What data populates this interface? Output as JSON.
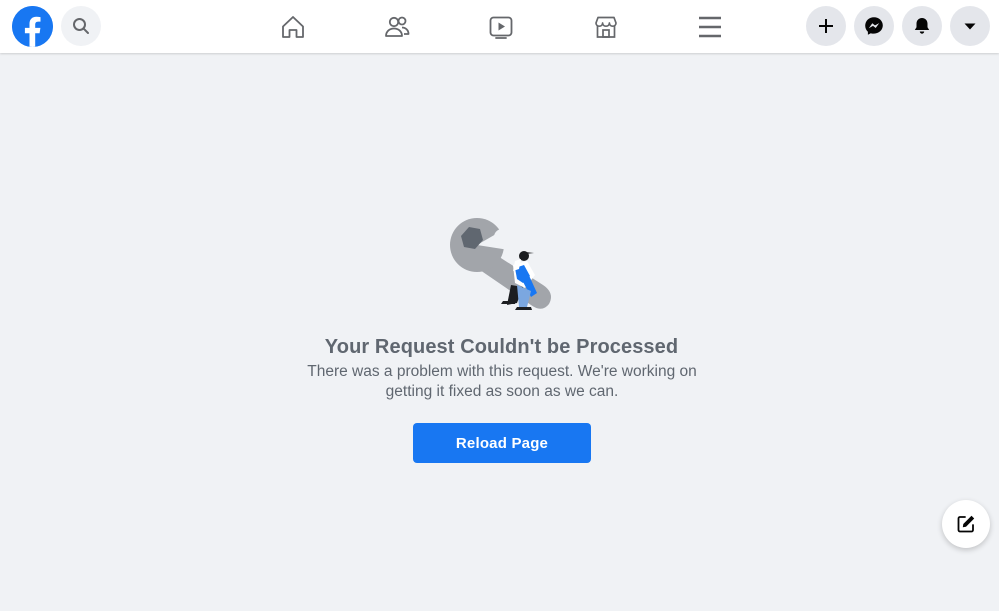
{
  "header": {
    "logo_icon": "facebook-logo-icon",
    "search_icon": "search-icon",
    "nav": [
      {
        "name": "home",
        "icon": "home-icon"
      },
      {
        "name": "friends",
        "icon": "friends-icon"
      },
      {
        "name": "watch",
        "icon": "video-icon"
      },
      {
        "name": "marketplace",
        "icon": "marketplace-icon"
      },
      {
        "name": "menu",
        "icon": "hamburger-menu-icon"
      }
    ],
    "actions": [
      {
        "name": "create",
        "icon": "plus-icon"
      },
      {
        "name": "messenger",
        "icon": "messenger-icon"
      },
      {
        "name": "notifications",
        "icon": "bell-icon"
      },
      {
        "name": "account",
        "icon": "caret-down-icon"
      }
    ]
  },
  "error": {
    "title": "Your Request Couldn't be Processed",
    "description": "There was a problem with this request. We're working on getting it fixed as soon as we can.",
    "button_label": "Reload Page",
    "illustration": "wrench-worker-illustration"
  },
  "compose": {
    "icon": "compose-icon"
  },
  "colors": {
    "brand": "#1877f2",
    "background": "#f0f2f5",
    "text_secondary": "#606770",
    "button_circle": "#e4e6eb"
  }
}
